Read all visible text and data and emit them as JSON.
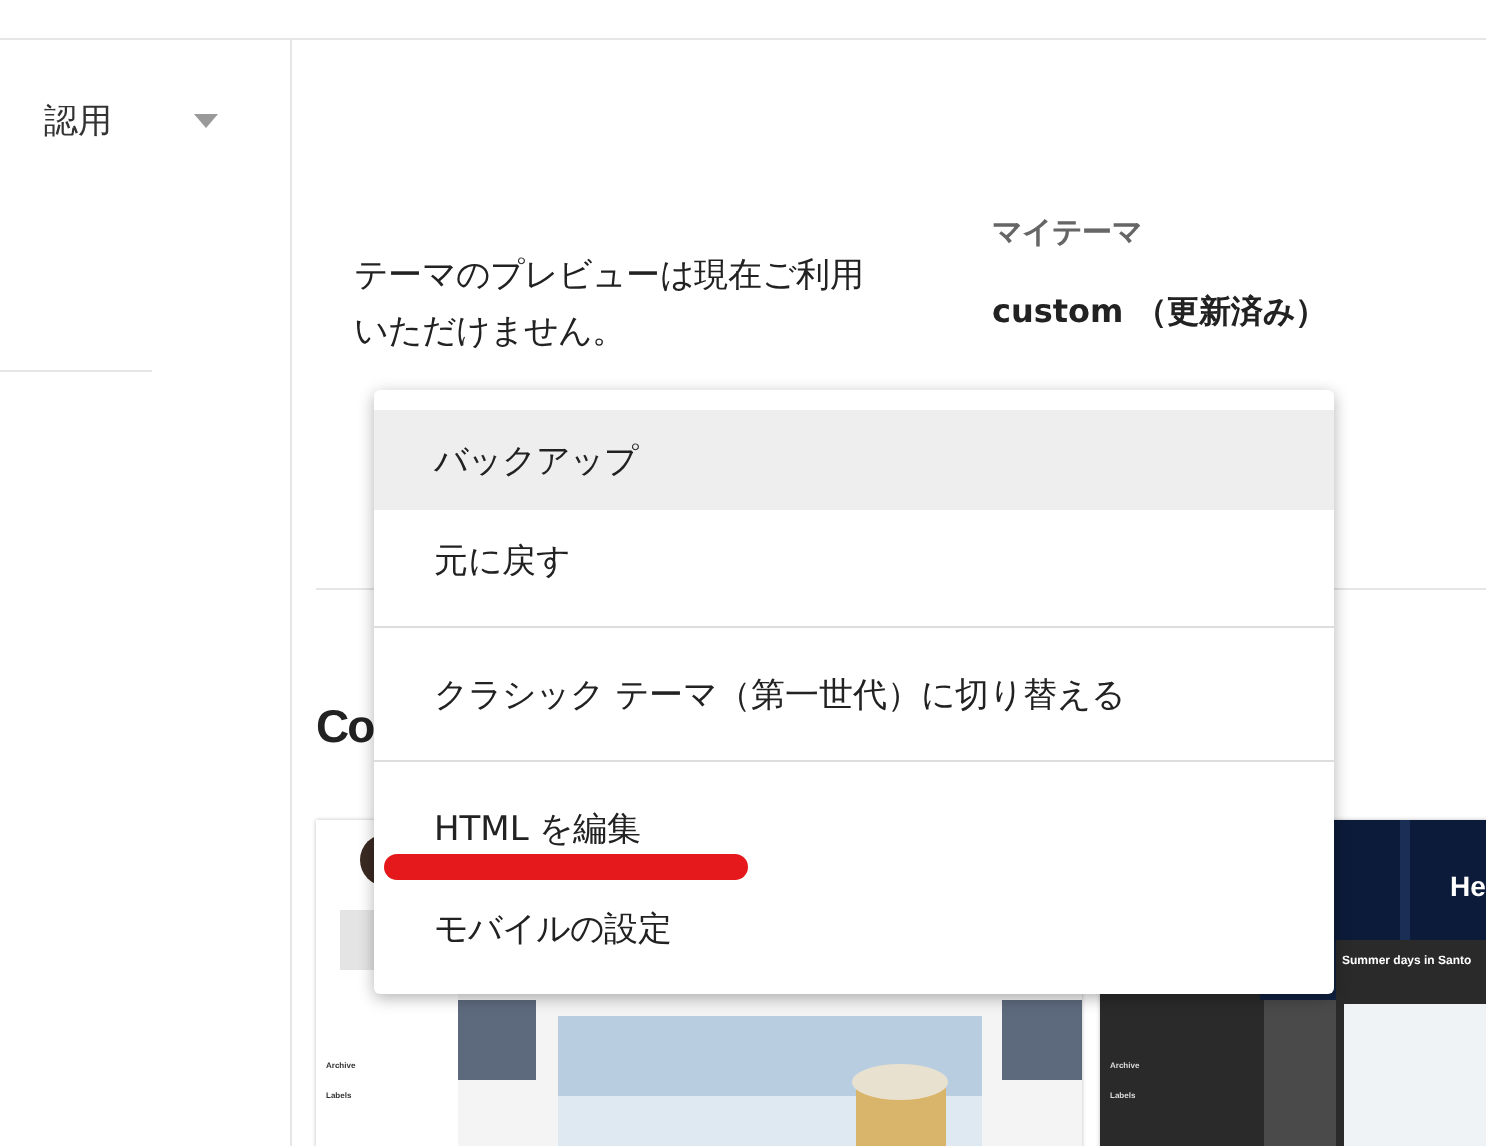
{
  "sidebar": {
    "blog_select": {
      "value": "認用"
    }
  },
  "theme": {
    "preview_notice": "テーマのプレビューは現在ご利用いただけません。",
    "my_theme_label": "マイテーマ",
    "current_theme": "custom （更新済み）"
  },
  "gallery": {
    "heading": "Co",
    "templates": [
      {
        "kind": "light",
        "labels": [
          "Archive",
          "Labels"
        ]
      },
      {
        "kind": "dark",
        "header": "He",
        "post_title": "Summer days in Santo",
        "labels": [
          "Archive",
          "Labels"
        ]
      }
    ]
  },
  "menu": {
    "items": [
      {
        "label": "バックアップ",
        "selected": true
      },
      {
        "label": "元に戻す",
        "selected": false
      },
      {
        "kind": "divider"
      },
      {
        "label": "クラシック テーマ（第一世代）に切り替える",
        "selected": false
      },
      {
        "kind": "divider"
      },
      {
        "label": "HTML を編集",
        "selected": false,
        "annotated": true
      },
      {
        "label": "モバイルの設定",
        "selected": false
      }
    ]
  }
}
